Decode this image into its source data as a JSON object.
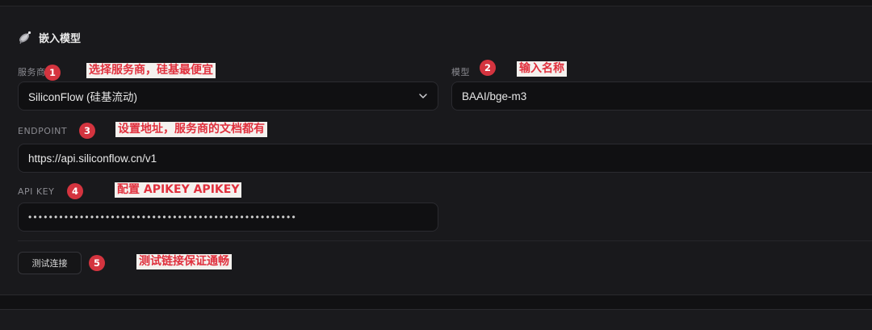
{
  "section": {
    "title": "嵌入模型",
    "icon": "satellite-dish-icon"
  },
  "provider": {
    "label": "服务商",
    "selected": "SiliconFlow (硅基流动)"
  },
  "model": {
    "label": "模型",
    "value": "BAAI/bge-m3"
  },
  "endpoint": {
    "label": "ENDPOINT",
    "value": "https://api.siliconflow.cn/v1"
  },
  "api_key": {
    "label": "API KEY",
    "masked_value": "••••••••••••••••••••••••••••••••••••••••••••••••••••"
  },
  "actions": {
    "test_connection": "测试连接"
  },
  "annotations": [
    {
      "number": "1",
      "text": "选择服务商，硅基最便宜"
    },
    {
      "number": "2",
      "text": "输入名称"
    },
    {
      "number": "3",
      "text": "设置地址，服务商的文档都有"
    },
    {
      "number": "4",
      "text": "配置 APIKEY APIKEY"
    },
    {
      "number": "5",
      "text": "测试链接保证通畅"
    }
  ],
  "colors": {
    "badge": "#d4343f",
    "note_text": "#e0303d",
    "note_bg": "#f4f1ee",
    "panel_bg": "#19191c",
    "field_bg": "#101012"
  }
}
